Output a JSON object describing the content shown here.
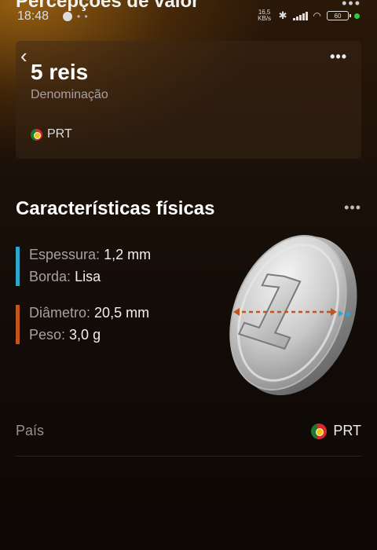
{
  "status_bar": {
    "time": "18:48",
    "speed": "16,5 KB/s",
    "battery": "60"
  },
  "header": {
    "title": "Percepções de valor",
    "more_label": "•••"
  },
  "card": {
    "denomination_value": "5 reis",
    "denomination_label": "Denominação",
    "country_code": "PRT",
    "more_label": "•••"
  },
  "physical": {
    "title": "Características físicas",
    "more_label": "•••",
    "group1": {
      "color": "#2aa7c9",
      "thickness_key": "Espessura:",
      "thickness_value": "1,2 mm",
      "edge_key": "Borda:",
      "edge_value": "Lisa"
    },
    "group2": {
      "color": "#c0561e",
      "diameter_key": "Diâmetro:",
      "diameter_value": "20,5 mm",
      "weight_key": "Peso:",
      "weight_value": "3,0 g"
    },
    "coin_numeral": "1"
  },
  "country": {
    "label": "País",
    "value": "PRT"
  },
  "colors": {
    "accent_blue": "#2aa7c9",
    "accent_orange": "#c0561e"
  }
}
